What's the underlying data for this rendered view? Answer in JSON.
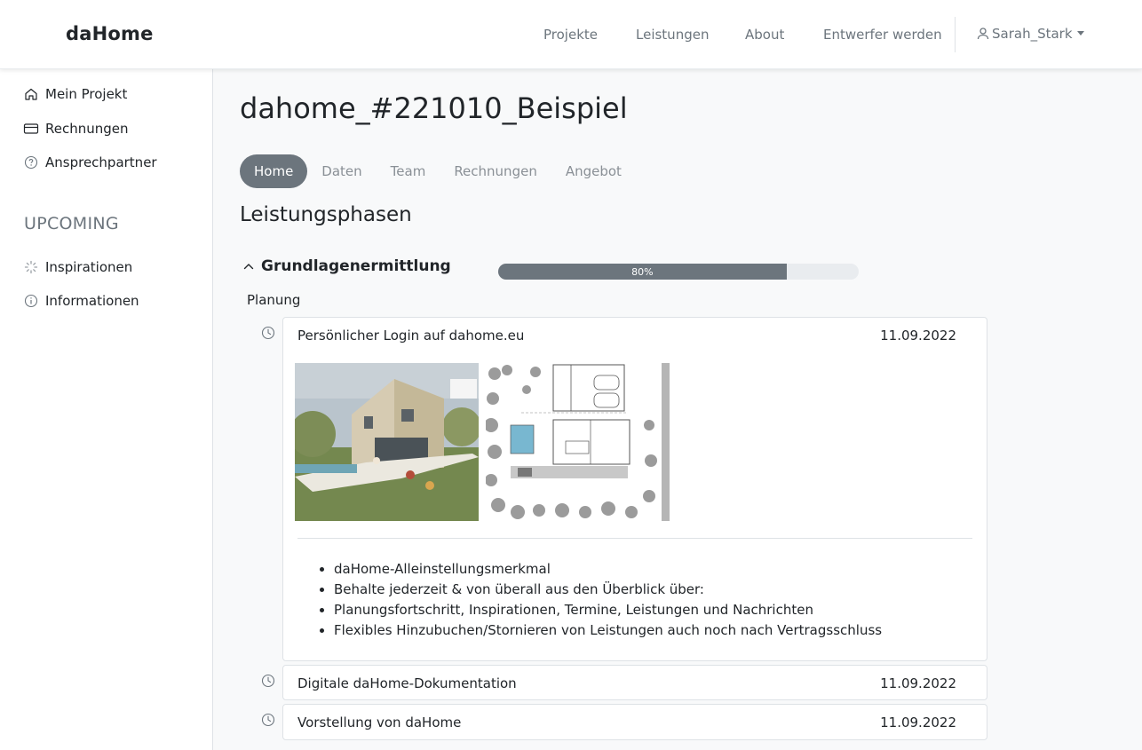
{
  "header": {
    "brand": "daHome",
    "nav": [
      "Projekte",
      "Leistungen",
      "About",
      "Entwerfer werden"
    ],
    "user": "Sarah_Stark"
  },
  "sidebar": {
    "items": [
      {
        "label": "Mein Projekt",
        "icon": "house-icon"
      },
      {
        "label": "Rechnungen",
        "icon": "credit-card-icon"
      },
      {
        "label": "Ansprechpartner",
        "icon": "question-circle-icon"
      }
    ],
    "upcoming_heading": "UPCOMING",
    "upcoming": [
      {
        "label": "Inspirationen",
        "icon": "spinner-icon"
      },
      {
        "label": "Informationen",
        "icon": "info-circle-icon"
      }
    ]
  },
  "main": {
    "title": "dahome_#221010_Beispiel",
    "tabs": [
      {
        "label": "Home",
        "active": true
      },
      {
        "label": "Daten",
        "active": false
      },
      {
        "label": "Team",
        "active": false
      },
      {
        "label": "Rechnungen",
        "active": false
      },
      {
        "label": "Angebot",
        "active": false
      }
    ],
    "section_title": "Leistungsphasen",
    "phase": {
      "title": "Grundlagenermittlung",
      "progress": 0.8,
      "progress_label": "80%",
      "subgroup": "Planung",
      "tasks": [
        {
          "title": "Persönlicher Login auf dahome.eu",
          "date": "11.09.2022",
          "expanded": true,
          "bullets": [
            "daHome-Alleinstellungsmerkmal",
            "Behalte jederzeit & von überall aus den Überblick über:",
            "Planungsfortschritt, Inspirationen, Termine, Leistungen und Nachrichten",
            "Flexibles Hinzubuchen/Stornieren von Leistungen auch noch nach Vertragsschluss"
          ]
        },
        {
          "title": "Digitale daHome-Dokumentation",
          "date": "11.09.2022",
          "expanded": false
        },
        {
          "title": "Vorstellung von daHome",
          "date": "11.09.2022",
          "expanded": false
        }
      ]
    }
  },
  "colors": {
    "accent": "#6c757d",
    "background": "#f8f9fa",
    "text": "#212529",
    "muted": "#6c757d"
  }
}
